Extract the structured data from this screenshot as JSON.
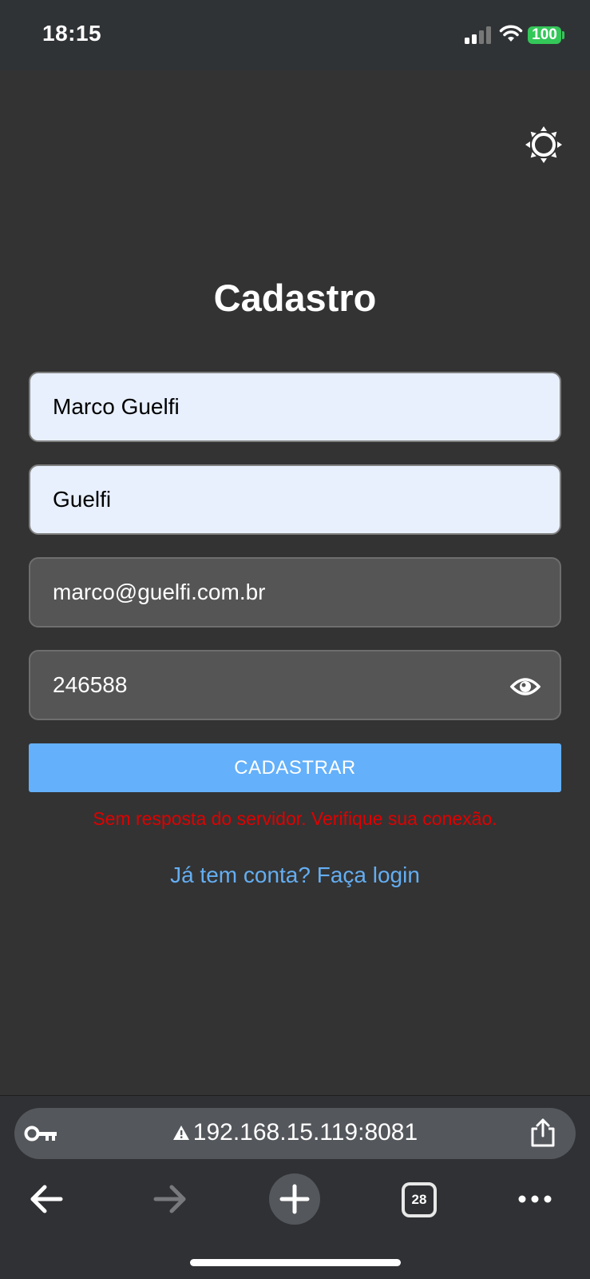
{
  "status_bar": {
    "time": "18:15",
    "battery": "100",
    "battery_color": "#34c759"
  },
  "header": {
    "theme_toggle_icon": "sun-icon"
  },
  "form": {
    "title": "Cadastro",
    "name_value": "Marco Guelfi",
    "username_value": "Guelfi",
    "email_value": "marco@guelfi.com.br",
    "password_value": "246588",
    "password_toggle_icon": "eye-icon",
    "submit_label": "CADASTRAR",
    "error_message": "Sem resposta do servidor. Verifique sua conexão.",
    "login_link": "Já tem conta? Faça login",
    "accent_color": "#64b0fa",
    "error_color": "#e00000"
  },
  "browser": {
    "url": "192.168.15.119:8081",
    "tab_count": "28",
    "icons": [
      "key-icon",
      "warning-icon",
      "share-icon",
      "back-arrow-icon",
      "forward-arrow-icon",
      "plus-icon",
      "tabs-icon",
      "more-icon"
    ]
  }
}
